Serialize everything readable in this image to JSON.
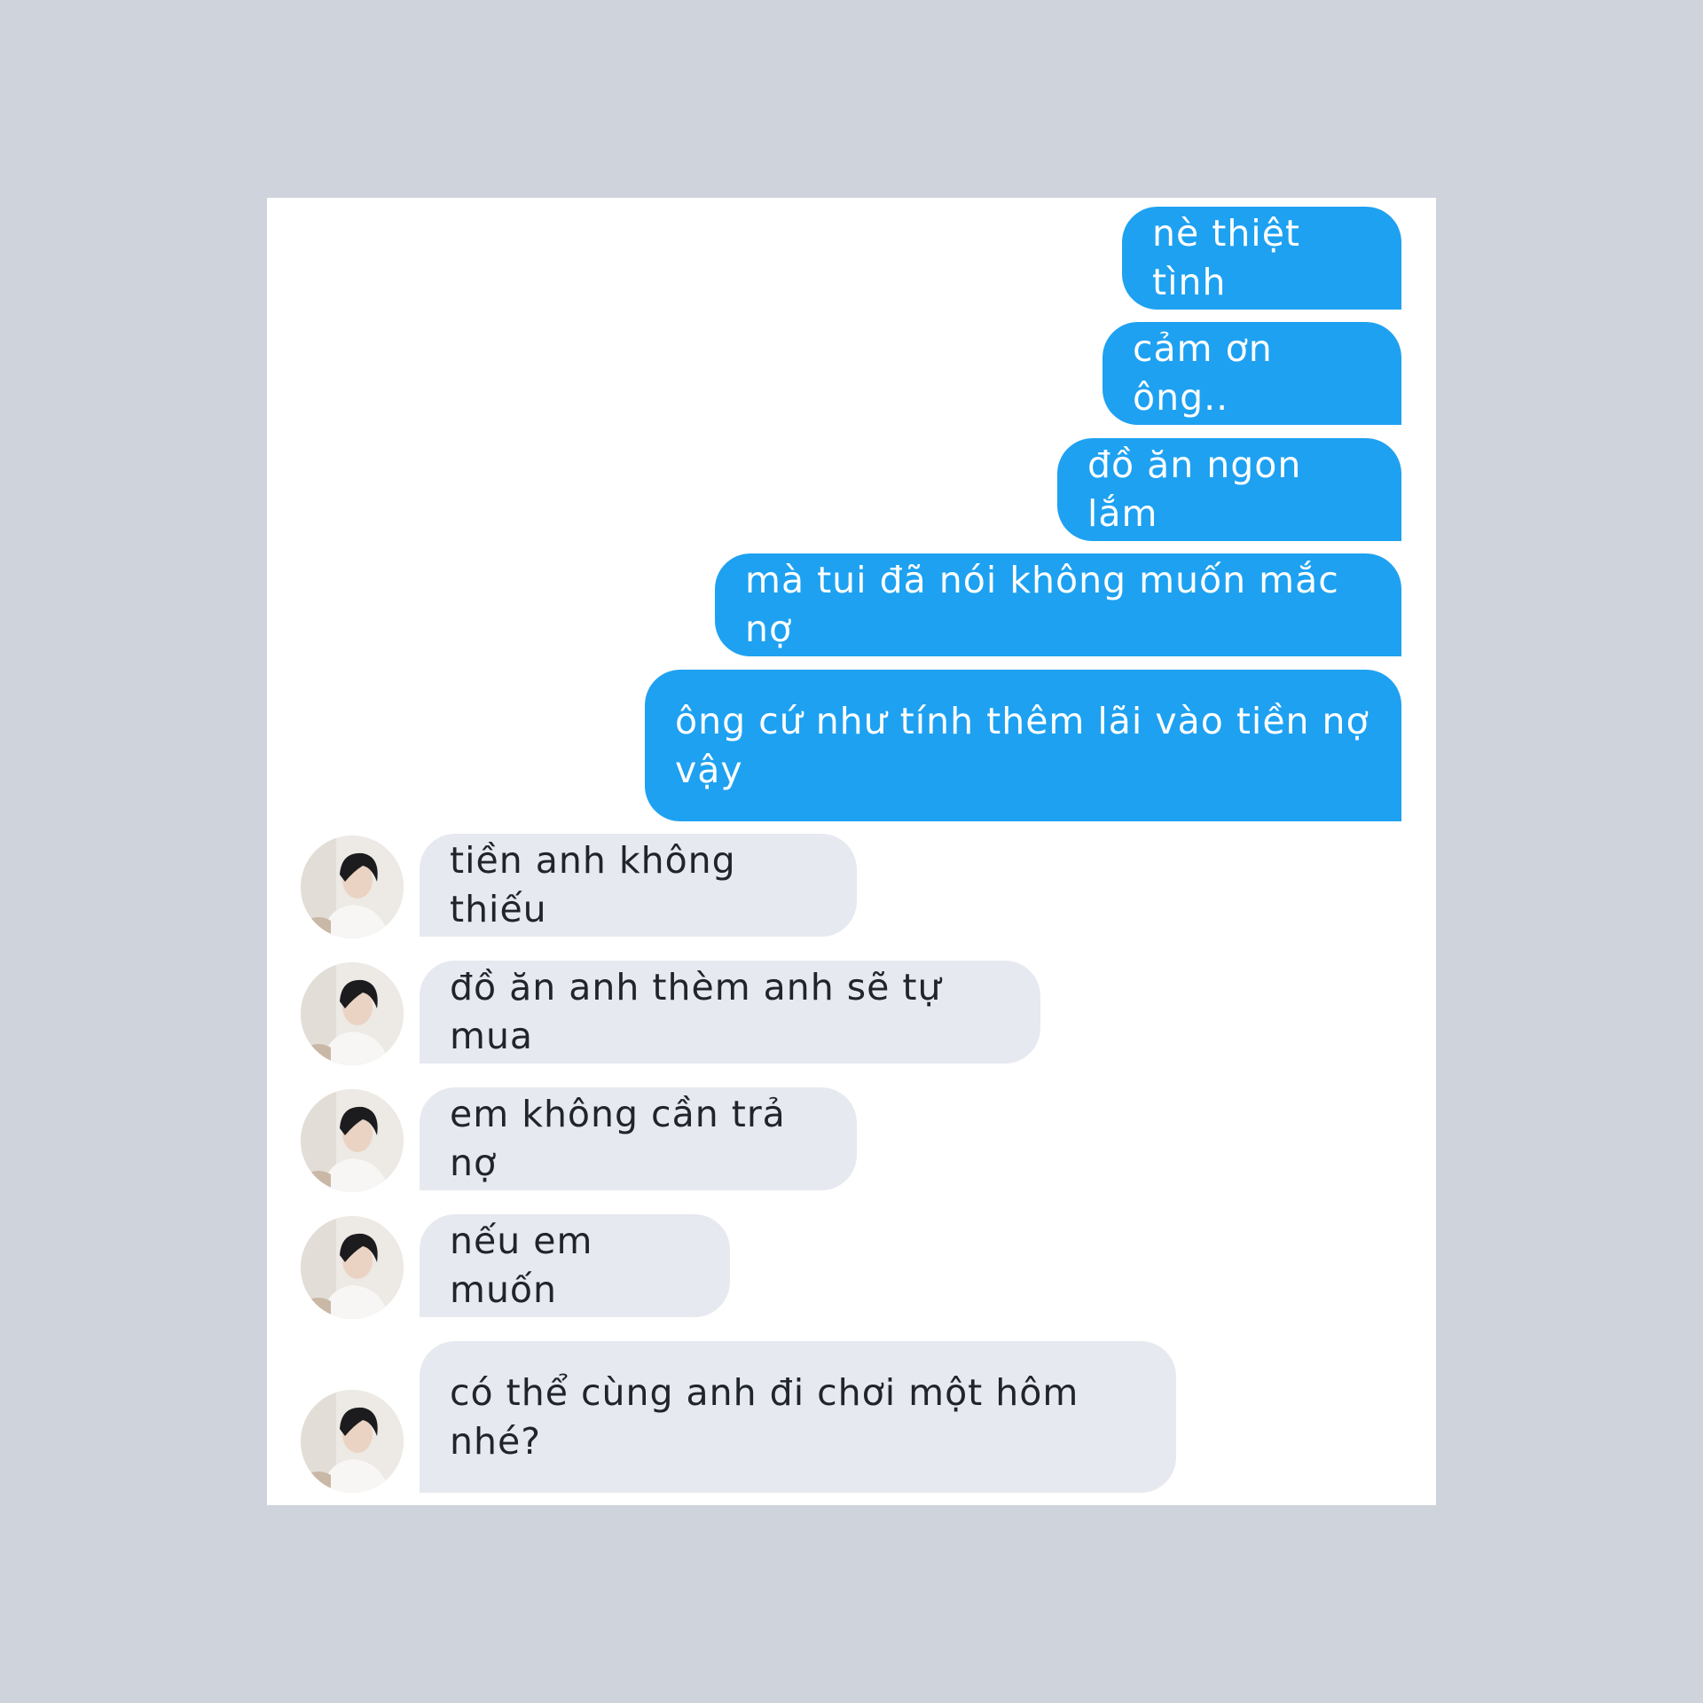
{
  "conversation": {
    "sent": [
      "nè thiệt tình",
      "cảm ơn ông..",
      "đồ ăn ngon lắm",
      "mà tui đã nói không muốn mắc nợ",
      "ông cứ như tính thêm lãi vào tiền nợ vậy"
    ],
    "received": [
      "tiền anh không thiếu",
      "đồ ăn anh thèm anh sẽ tự mua",
      "em không cần trả nợ",
      "nếu em muốn",
      "có thể cùng anh đi chơi một hôm nhé?"
    ]
  },
  "colors": {
    "background": "#cfd3db",
    "sent_bubble": "#1ea1f1",
    "received_bubble": "#e6e9ef"
  },
  "icons": {
    "avatar": "profile-photo"
  }
}
